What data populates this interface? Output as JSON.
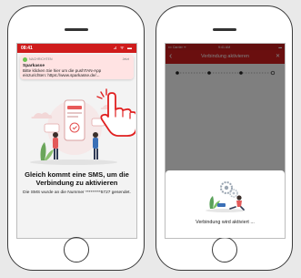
{
  "phone1": {
    "status_bar": {
      "time": "08:41",
      "icons": "⊿ ᯤ ▬"
    },
    "notification": {
      "app_name": "NACHRICHTEN",
      "time": "Jetzt",
      "sender": "Sparkasse",
      "body": "Bitte klicken Sie hier um die pushTAN-App einzurichten: https://www.sparkasse.de/..."
    },
    "heading": "Gleich kommt eine SMS, um die Verbindung zu aktivieren",
    "subtext": "Die SMS wurde an die Nummer *********5727 gesendet."
  },
  "phone2": {
    "status_bar": {
      "carrier": "▪▪▪ Carrier ᯤ",
      "time": "9:41 AM",
      "battery": "▬"
    },
    "nav": {
      "back": "‹",
      "title": "Verbindung aktivieren",
      "close": "✕"
    },
    "sheet": {
      "status_text": "Verbindung wird aktiviert ..."
    }
  },
  "colors": {
    "brand_red": "#d41f1f",
    "status_red": "#cf1c1c",
    "notification_bg": "#ffe2e2",
    "accent_green": "#6ac44e"
  }
}
